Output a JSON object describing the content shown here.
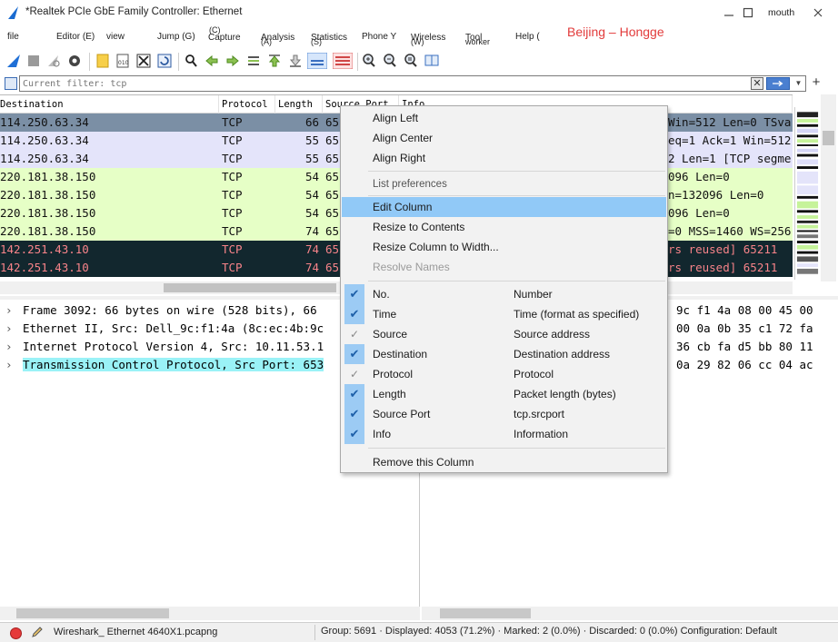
{
  "window": {
    "title": "*Realtek PCIe GbE Family Controller: Ethernet",
    "user": "mouth"
  },
  "menu": [
    {
      "label": "file"
    },
    {
      "label": "Editor (E)"
    },
    {
      "label": "view"
    },
    {
      "label": "Jump (G)"
    },
    {
      "label": "Capture",
      "accel": "(C)"
    },
    {
      "label": "Analysis",
      "accel": "(A)"
    },
    {
      "label": "Statistics",
      "accel": "(S)"
    },
    {
      "label": "Phone Y"
    },
    {
      "label": "Wireless",
      "accel": "(W)"
    },
    {
      "label": "Tool",
      "sub": "worker"
    },
    {
      "label": "Help ("
    }
  ],
  "annotation": "Beijing – Hongge",
  "toolbar_icons": [
    "shark-fin-start-icon",
    "stop-icon",
    "restart-icon",
    "options-gear-icon",
    "open-folder-icon",
    "save-file-icon",
    "close-file-icon",
    "reload-icon",
    "find-icon",
    "go-back-icon",
    "go-forward-icon",
    "go-to-packet-icon",
    "first-packet-icon",
    "last-packet-icon",
    "autoscroll-icon",
    "colorize-icon",
    "zoom-in-icon",
    "zoom-out-icon",
    "zoom-reset-icon",
    "resize-columns-icon"
  ],
  "filter": {
    "placeholder": "Current filter: tcp",
    "value": ""
  },
  "packet_list": {
    "columns": [
      "Destination",
      "Protocol",
      "Length",
      "Source Port",
      "Info"
    ],
    "rows": [
      {
        "dest": "114.250.63.34",
        "proto": "TCP",
        "len": "66",
        "port": "65",
        "info": "Win=512 Len=0 TSva",
        "style": "selected"
      },
      {
        "dest": "114.250.63.34",
        "proto": "TCP",
        "len": "55",
        "port": "65",
        "info": "eq=1 Ack=1 Win=512",
        "style": "lavender"
      },
      {
        "dest": "114.250.63.34",
        "proto": "TCP",
        "len": "55",
        "port": "65",
        "info": "2 Len=1 [TCP segme",
        "style": "lavender"
      },
      {
        "dest": "220.181.38.150",
        "proto": "TCP",
        "len": "54",
        "port": "65",
        "info": "096 Len=0",
        "style": "green"
      },
      {
        "dest": "220.181.38.150",
        "proto": "TCP",
        "len": "54",
        "port": "65",
        "info": "n=132096 Len=0",
        "style": "green"
      },
      {
        "dest": "220.181.38.150",
        "proto": "TCP",
        "len": "54",
        "port": "65",
        "info": "096 Len=0",
        "style": "green"
      },
      {
        "dest": "220.181.38.150",
        "proto": "TCP",
        "len": "74",
        "port": "65",
        "info": "=0 MSS=1460 WS=256",
        "style": "green"
      },
      {
        "dest": "142.251.43.10",
        "proto": "TCP",
        "len": "74",
        "port": "65",
        "info": "rs reused] 65211",
        "style": "dark"
      },
      {
        "dest": "142.251.43.10",
        "proto": "TCP",
        "len": "74",
        "port": "65",
        "info": "rs reused] 65211",
        "style": "dark"
      }
    ]
  },
  "details": [
    {
      "text": "Frame 3092: 66 bytes on wire (528 bits), 66"
    },
    {
      "text": "Ethernet II, Src: Dell_9c:f1:4a (8c:ec:4b:9c"
    },
    {
      "text": "Internet Protocol Version 4, Src: 10.11.53.1"
    },
    {
      "text": "Transmission Control Protocol, Src Port: 653",
      "selected": true
    }
  ],
  "bytes": [
    "9c f1 4a 08 00 45 00",
    "00 0a 0b 35 c1 72 fa",
    "36 cb fa d5 bb 80 11",
    "0a 29 82 06 cc 04 ac"
  ],
  "context_menu": {
    "top_items": [
      "Align Left",
      "Align Center",
      "Align Right"
    ],
    "section_label": "List preferences",
    "mid_items": [
      {
        "label": "Edit Column",
        "highlighted": true
      },
      {
        "label": "Resize to Contents"
      },
      {
        "label": "Resize Column to Width..."
      },
      {
        "label": "Resolve Names",
        "disabled": true
      }
    ],
    "columns": [
      {
        "label": "No.",
        "desc": "Number",
        "state": "checked"
      },
      {
        "label": "Time",
        "desc": "Time (format as specified)",
        "state": "checked"
      },
      {
        "label": "Source",
        "desc": "Source address",
        "state": "partial"
      },
      {
        "label": "Destination",
        "desc": "Destination address",
        "state": "checked"
      },
      {
        "label": "Protocol",
        "desc": "Protocol",
        "state": "partial"
      },
      {
        "label": "Length",
        "desc": "Packet length (bytes)",
        "state": "checked"
      },
      {
        "label": "Source Port",
        "desc": "tcp.srcport",
        "state": "checked"
      },
      {
        "label": "Info",
        "desc": "Information",
        "state": "checked"
      }
    ],
    "remove_label": "Remove this Column"
  },
  "status": {
    "file": "Wireshark_ Ethernet 4640X1.pcapng",
    "stats": "Group: 5691 · Displayed: 4053 (71.2%) · Marked: 2 (0.0%) · Discarded: 0 (0.0%) Configuration: Default"
  },
  "colors": {
    "selected_row": "#7b8fa5",
    "lavender_row": "#e4e4fa",
    "green_row": "#e6ffc6",
    "dark_row": "#12272e",
    "dark_row_text": "#f78389",
    "menu_highlight": "#91c9f7",
    "detail_selected": "#9af2f7"
  }
}
